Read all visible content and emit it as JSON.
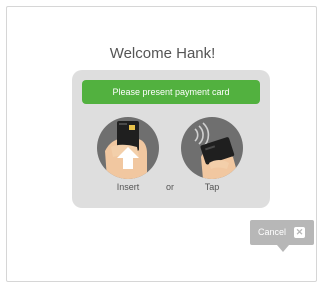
{
  "welcome": {
    "title": "Welcome Hank!"
  },
  "payment": {
    "banner": "Please present payment card",
    "insert_label": "Insert",
    "or_label": "or",
    "tap_label": "Tap",
    "insert_icon": "card-insert-icon",
    "tap_icon": "contactless-tap-icon"
  },
  "actions": {
    "cancel_label": "Cancel",
    "cancel_icon": "close-icon"
  },
  "colors": {
    "accent": "#52b13f",
    "panel": "#dedede",
    "icon_bg": "#6f6f6f",
    "cancel_bg": "#b7b7b7",
    "text": "#555555"
  }
}
